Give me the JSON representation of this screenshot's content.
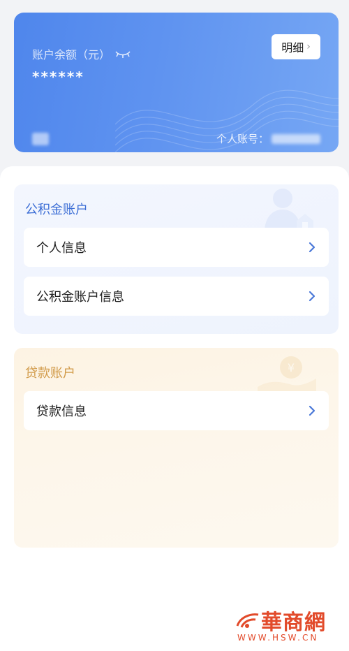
{
  "balance_card": {
    "label": "账户余额（元）",
    "masked_value": "******",
    "detail_button": "明细",
    "account_label": "个人账号："
  },
  "fund_section": {
    "title": "公积金账户",
    "items": [
      {
        "label": "个人信息"
      },
      {
        "label": "公积金账户信息"
      }
    ]
  },
  "loan_section": {
    "title": "贷款账户",
    "items": [
      {
        "label": "贷款信息"
      }
    ]
  },
  "watermark": {
    "title": "華商網",
    "url": "WWW.HSW.CN"
  },
  "colors": {
    "card_blue": "#5a8ff0",
    "fund_title": "#3d6fd6",
    "loan_title": "#d19a48",
    "chevron_blue": "#4a78d8",
    "watermark_red": "#e24a2a"
  }
}
